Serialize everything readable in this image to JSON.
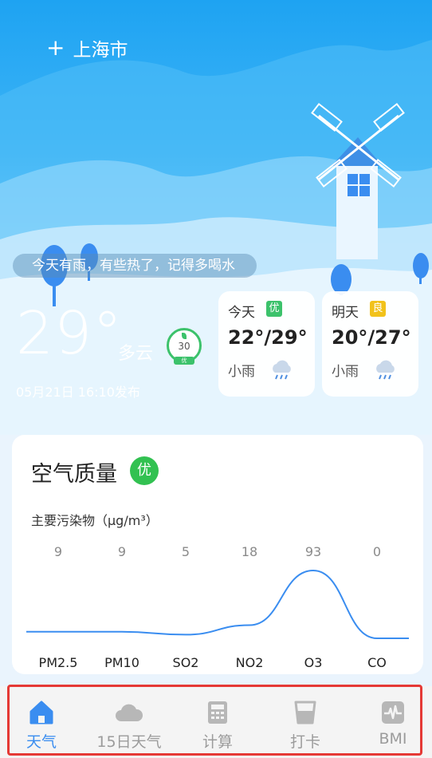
{
  "header": {
    "city": "上海市",
    "add_icon": "plus-icon"
  },
  "tip": "今天有雨，有些热了，记得多喝水",
  "current": {
    "temperature": "29°",
    "condition": "多云",
    "aqi_value": "30",
    "aqi_level": "优",
    "published": "05月21日 16:10发布"
  },
  "forecast": [
    {
      "day": "今天",
      "quality": "优",
      "quality_color": "#3cc26b",
      "range": "22°/29°",
      "desc": "小雨",
      "icon": "light-rain-icon"
    },
    {
      "day": "明天",
      "quality": "良",
      "quality_color": "#f2c21b",
      "range": "20°/27°",
      "desc": "小雨",
      "icon": "light-rain-icon"
    }
  ],
  "air_quality": {
    "title": "空气质量",
    "level": "优",
    "pollutant_label": "主要污染物（μg/m³）"
  },
  "chart_data": {
    "type": "area",
    "categories": [
      "PM2.5",
      "PM10",
      "SO2",
      "NO2",
      "O3",
      "CO"
    ],
    "values": [
      9,
      9,
      5,
      18,
      93,
      0
    ],
    "color": "#3a8df0"
  },
  "tabs": [
    {
      "label": "天气",
      "icon": "home-icon",
      "active": true
    },
    {
      "label": "15日天气",
      "icon": "cloud-icon",
      "active": false
    },
    {
      "label": "计算",
      "icon": "calculator-icon",
      "active": false
    },
    {
      "label": "打卡",
      "icon": "cup-icon",
      "active": false
    },
    {
      "label": "BMI",
      "icon": "pulse-icon",
      "active": false
    }
  ]
}
